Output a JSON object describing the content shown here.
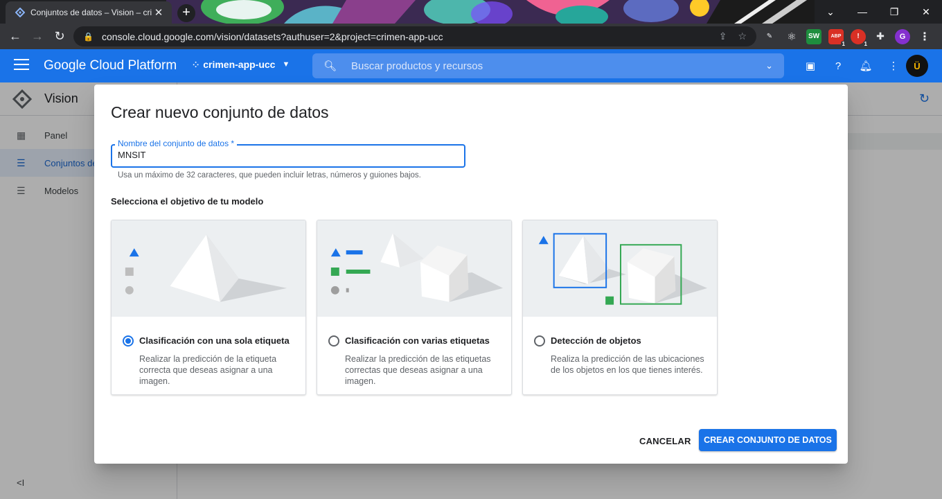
{
  "browser": {
    "tab_title": "Conjuntos de datos – Vision – cri",
    "new_tab": "+",
    "url": "console.cloud.google.com/vision/datasets?authuser=2&project=crimen-app-ucc",
    "extensions": [
      {
        "icon": "ext-stitch-icon",
        "label": ""
      },
      {
        "icon": "react-icon",
        "label": "⚛"
      },
      {
        "icon": "sw-icon",
        "label": "SW"
      },
      {
        "icon": "adblock-icon",
        "label": "ABP",
        "badge": "1"
      },
      {
        "icon": "ext-red-icon",
        "label": "!",
        "badge": "1"
      },
      {
        "icon": "puzzle-icon",
        "label": "✚"
      },
      {
        "icon": "profile-icon",
        "label": "G"
      }
    ]
  },
  "gcp": {
    "title": "Google Cloud Platform",
    "project": "crimen-app-ucc",
    "search_placeholder": "Buscar productos y recursos",
    "avatar_text": "Ü"
  },
  "sidebar": {
    "product": "Vision",
    "items": [
      {
        "label": "Panel",
        "icon": "dashboard-icon"
      },
      {
        "label": "Conjuntos de",
        "icon": "list-icon"
      },
      {
        "label": "Modelos",
        "icon": "list-icon"
      }
    ],
    "collapse": "<I"
  },
  "dialog": {
    "title": "Crear nuevo conjunto de datos",
    "field_label": "Nombre del conjunto de datos *",
    "field_value": "MNSIT",
    "hint": "Usa un máximo de 32 caracteres, que pueden incluir letras, números y guiones bajos.",
    "section_label": "Selecciona el objetivo de tu modelo",
    "options": [
      {
        "title": "Clasificación con una sola etiqueta",
        "desc": "Realizar la predicción de la etiqueta correcta que deseas asignar a una imagen.",
        "selected": true
      },
      {
        "title": "Clasificación con varias etiquetas",
        "desc": "Realizar la predicción de las etiquetas correctas que deseas asignar a una imagen.",
        "selected": false
      },
      {
        "title": "Detección de objetos",
        "desc": "Realiza la predicción de las ubicaciones de los objetos en los que tienes interés.",
        "selected": false
      }
    ],
    "cancel": "CANCELAR",
    "create": "CREAR CONJUNTO DE DATOS"
  },
  "colors": {
    "primary": "#1a73e8",
    "green": "#34a853",
    "illustration_bg": "#eceff1"
  }
}
